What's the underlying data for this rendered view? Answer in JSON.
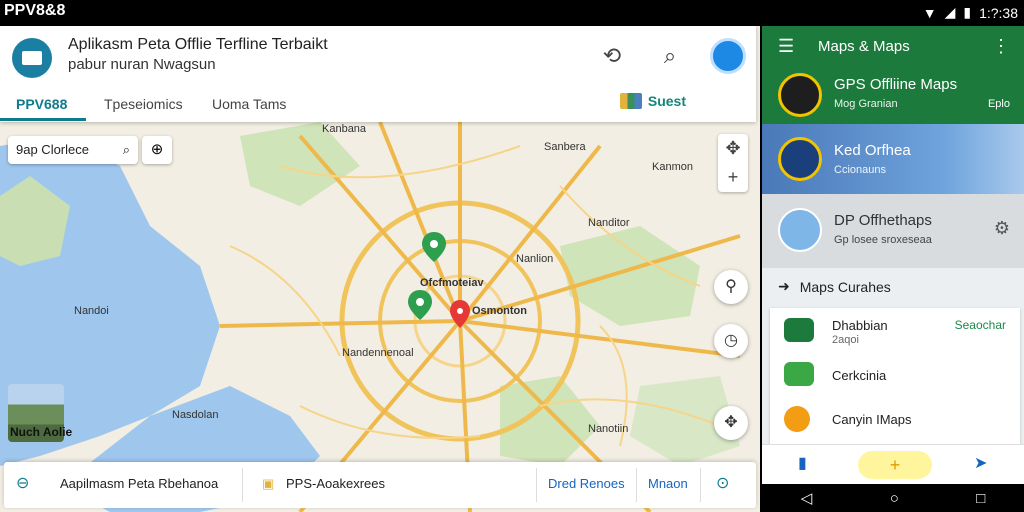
{
  "statusbar": {
    "left_text": "PPV8&8",
    "time": "1:?:38",
    "wifi_icon": "wifi-icon",
    "signal_icon": "signal-icon",
    "battery_icon": "battery-icon"
  },
  "app": {
    "title": "Aplikasm Peta Offlie Terfline Terbaikt",
    "subtitle": "pabur nuran Nwagsun",
    "actions": [
      "share-icon",
      "search-icon",
      "avatar"
    ],
    "tabs": [
      "PPV688",
      "Tpeseiomics",
      "Uoma Tams"
    ],
    "suggest_label": "Suest"
  },
  "map": {
    "search_text": "9ap Clorlece",
    "labels": [
      "Kanbana",
      "Sanbera",
      "Kanmon",
      "Nanditor",
      "Nanlion",
      "Nandoi",
      "Ofcfmoteiav",
      "Osmonton",
      "Nandennenoal",
      "Nasdolan",
      "Nanotiin"
    ],
    "thumbnail_label": "Nuch Aolie"
  },
  "bottombar": {
    "items": [
      "Aapilmasm Peta Rbehanoa",
      "PPS-Aoakexrees",
      "Dred Renoes",
      "Mnaon"
    ]
  },
  "drawer": {
    "header_title": "Maps & Maps",
    "cards": [
      {
        "title": "GPS Offliine Maps",
        "subtitle": "Mog Granian",
        "right": "Eplo"
      },
      {
        "title": "Ked Orfhea",
        "subtitle": "Ccionauns"
      },
      {
        "title": "DP Offhethaps",
        "subtitle": "Gp losee sroxeseaa"
      }
    ],
    "section_title": "Maps Curahes",
    "list": [
      {
        "title": "Dhabbian",
        "subtitle": "2aqoi",
        "action": "Seaochar"
      },
      {
        "title": "Cerkcinia",
        "subtitle": "",
        "action": ""
      },
      {
        "title": "Canyin IMaps",
        "subtitle": "",
        "action": ""
      }
    ],
    "add_symbol": "+"
  },
  "colors": {
    "accent": "#0f7b8c",
    "drawer_green": "#1c7a3c",
    "pin_red": "#e53935"
  }
}
